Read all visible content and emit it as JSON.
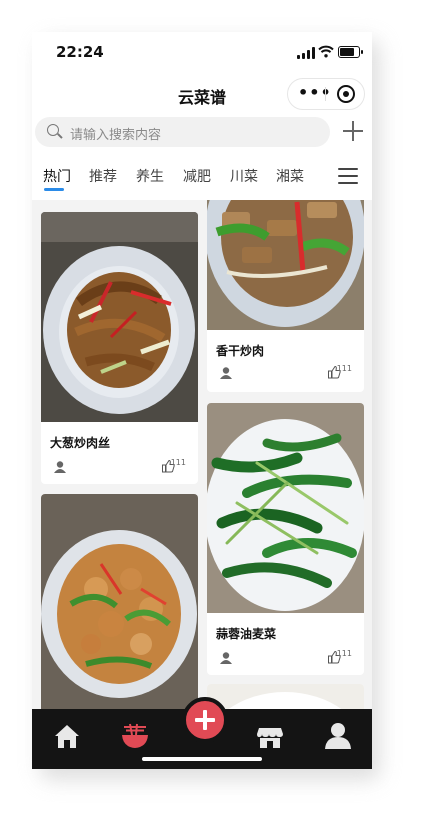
{
  "status_bar": {
    "time": "22:24"
  },
  "navbar": {
    "title": "云菜谱",
    "menu_dots": "•••"
  },
  "search": {
    "placeholder": "请输入搜索内容"
  },
  "categories": [
    {
      "label": "热门",
      "active": true
    },
    {
      "label": "推荐",
      "active": false
    },
    {
      "label": "养生",
      "active": false
    },
    {
      "label": "减肥",
      "active": false
    },
    {
      "label": "川菜",
      "active": false
    },
    {
      "label": "湘菜",
      "active": false
    }
  ],
  "recipes": {
    "left": [
      {
        "name": "大葱炒肉丝",
        "likes": "111"
      },
      {
        "name": "",
        "likes": ""
      }
    ],
    "right": [
      {
        "name": "香干炒肉",
        "likes": "111"
      },
      {
        "name": "蒜蓉油麦菜",
        "likes": "111"
      },
      {
        "name": "",
        "likes": ""
      }
    ]
  },
  "tabbar": {
    "items": [
      "home-icon",
      "recipe-bowl-icon",
      "add-icon",
      "store-icon",
      "profile-icon"
    ],
    "colors": {
      "background": "#141414",
      "active": "#e14a55",
      "inactive": "#e8e8e8"
    }
  },
  "colors": {
    "accent": "#2b8be8",
    "add_button": "#e14a55"
  }
}
